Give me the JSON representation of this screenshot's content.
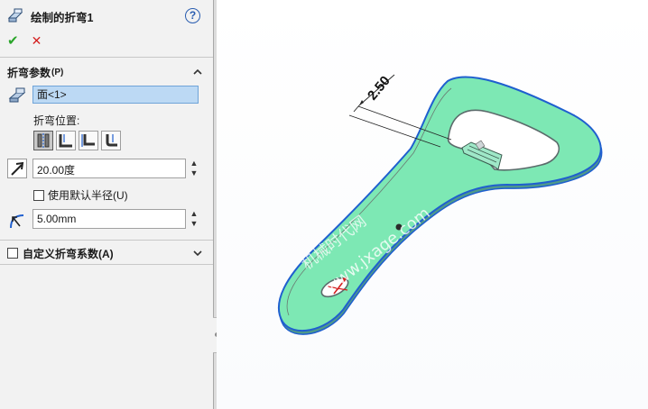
{
  "feature": {
    "title": "绘制的折弯1",
    "help_symbol": "?",
    "ok_symbol": "✔",
    "cancel_symbol": "✕"
  },
  "bend_params": {
    "section_title": "折弯参数",
    "section_suffix": "(P)",
    "face_value": "面<1>",
    "bend_position_label": "折弯位置:",
    "bend_position_options": [
      "中心线",
      "材料在内",
      "材料在外",
      "折弯在外"
    ],
    "selected_position_index": 0,
    "angle_value": "20.00度",
    "use_default_radius_label": "使用默认半径(U)",
    "use_default_radius_checked": false,
    "radius_value": "5.00mm"
  },
  "custom_bend": {
    "section_title": "自定义折弯系数(A)",
    "checked": false
  },
  "viewport": {
    "dimension_label": "2.50",
    "watermark_cn": "机械时代网",
    "watermark_url": "www.jxage.com"
  },
  "colors": {
    "part_face": "#7de8b4",
    "part_edge": "#1f5fcf",
    "panel_bg": "#f2f2f2",
    "selection_bg": "#bcd9f4"
  }
}
